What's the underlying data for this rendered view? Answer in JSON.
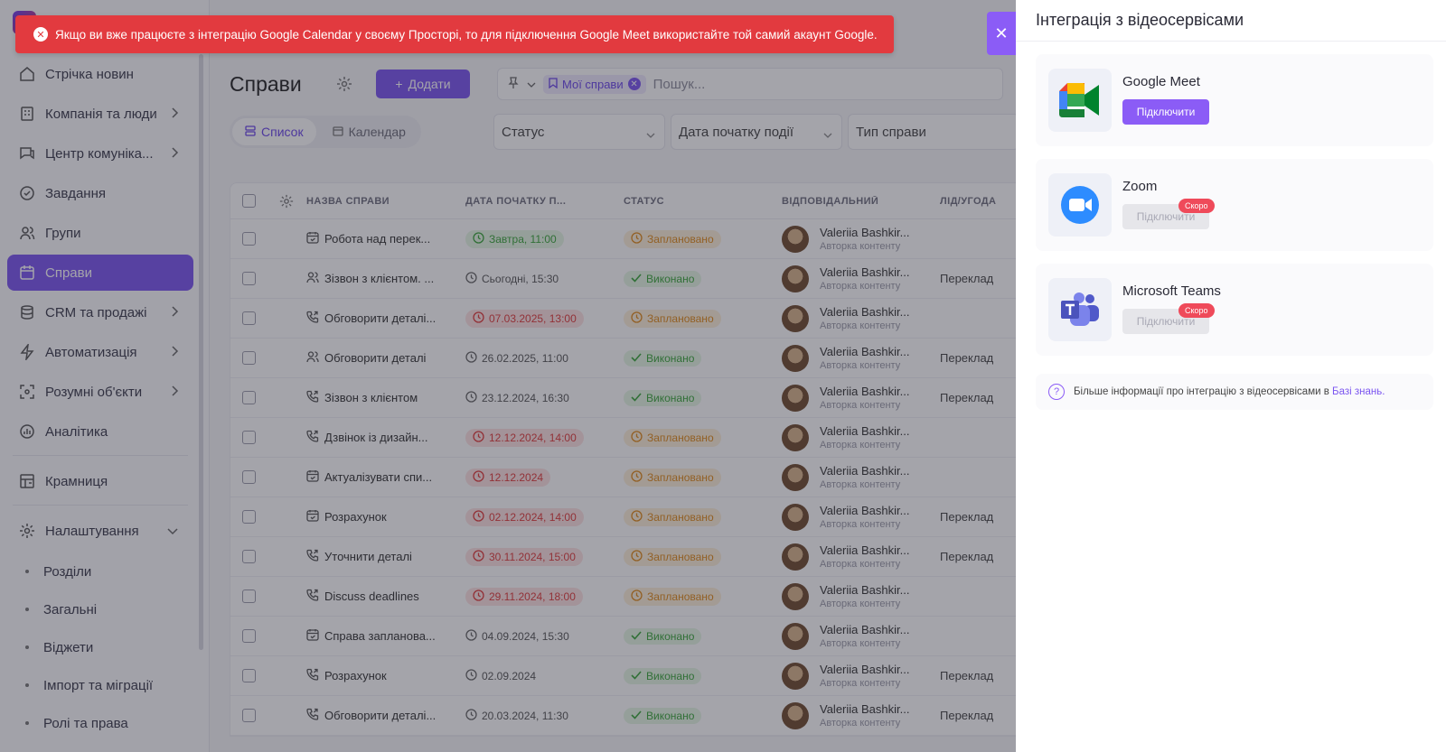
{
  "alert": {
    "text": "Якщо ви вже працюєте з інтеграцію Google Calendar у своєму Просторі, то для підключення Google Meet використайте той самий акаунт Google."
  },
  "sidebar": {
    "items": [
      {
        "label": "Стрічка новин",
        "icon": "newspaper-icon"
      },
      {
        "label": "Компанія та люди",
        "icon": "building-icon",
        "chevron": true
      },
      {
        "label": "Центр комуніка...",
        "icon": "chat-icon",
        "chevron": true
      },
      {
        "label": "Завдання",
        "icon": "check-circle-icon"
      },
      {
        "label": "Групи",
        "icon": "users-icon"
      },
      {
        "label": "Справи",
        "icon": "calendar-icon",
        "active": true
      },
      {
        "label": "CRM та продажі",
        "icon": "database-icon",
        "chevron": true
      },
      {
        "label": "Автоматизація",
        "icon": "bolt-icon",
        "chevron": true
      },
      {
        "label": "Розумні об'єкти",
        "icon": "scan-icon",
        "chevron": true
      },
      {
        "label": "Аналітика",
        "icon": "chart-icon"
      }
    ],
    "store": "Крамниця",
    "settings": "Налаштування",
    "settings_sub": [
      "Розділи",
      "Загальні",
      "Віджети",
      "Імпорт та міграції",
      "Ролі та права"
    ]
  },
  "main": {
    "title": "Справи",
    "add_label": "Додати",
    "filter_chip": "Мої справи",
    "search_placeholder": "Пошук...",
    "view_tabs": [
      "Список",
      "Календар"
    ],
    "filters": [
      "Статус",
      "Дата початку події",
      "Тип справи"
    ],
    "columns": [
      "НАЗВА СПРАВИ",
      "ДАТА ПОЧАТКУ П...",
      "СТАТУС",
      "ВІДПОВІДАЛЬНИЙ",
      "ЛІД/УГОДА"
    ],
    "rows": [
      {
        "name": "Робота над перек...",
        "type": "calendar",
        "date": "Завтра, 11:00",
        "date_style": "green",
        "status": "Заплановано",
        "status_style": "orange",
        "resp": "Valeriia Bashkir...",
        "role": "Авторка контенту",
        "lead": ""
      },
      {
        "name": "Зізвон з клієнтом. ...",
        "type": "users",
        "date": "Сьогодні, 15:30",
        "date_style": "gray",
        "status": "Виконано",
        "status_style": "green",
        "resp": "Valeriia Bashkir...",
        "role": "Авторка контенту",
        "lead": "Переклад"
      },
      {
        "name": "Обговорити деталі...",
        "type": "phone",
        "date": "07.03.2025, 13:00",
        "date_style": "red",
        "status": "Заплановано",
        "status_style": "orange",
        "resp": "Valeriia Bashkir...",
        "role": "Авторка контенту",
        "lead": ""
      },
      {
        "name": "Обговорити деталі",
        "type": "users",
        "date": "26.02.2025, 11:00",
        "date_style": "gray",
        "status": "Виконано",
        "status_style": "green",
        "resp": "Valeriia Bashkir...",
        "role": "Авторка контенту",
        "lead": "Переклад"
      },
      {
        "name": "Зізвон з клієнтом",
        "type": "phone",
        "date": "23.12.2024, 16:30",
        "date_style": "gray",
        "status": "Виконано",
        "status_style": "green",
        "resp": "Valeriia Bashkir...",
        "role": "Авторка контенту",
        "lead": "Переклад"
      },
      {
        "name": "Дзвінок із дизайн...",
        "type": "phone",
        "date": "12.12.2024, 14:00",
        "date_style": "red",
        "status": "Заплановано",
        "status_style": "orange",
        "resp": "Valeriia Bashkir...",
        "role": "Авторка контенту",
        "lead": ""
      },
      {
        "name": "Актуалізувати спи...",
        "type": "calendar",
        "date": "12.12.2024",
        "date_style": "red",
        "status": "Заплановано",
        "status_style": "orange",
        "resp": "Valeriia Bashkir...",
        "role": "Авторка контенту",
        "lead": ""
      },
      {
        "name": "Розрахунок",
        "type": "calendar",
        "date": "02.12.2024, 14:00",
        "date_style": "red",
        "status": "Заплановано",
        "status_style": "orange",
        "resp": "Valeriia Bashkir...",
        "role": "Авторка контенту",
        "lead": "Переклад"
      },
      {
        "name": "Уточнити деталі",
        "type": "phone",
        "date": "30.11.2024, 15:00",
        "date_style": "red",
        "status": "Заплановано",
        "status_style": "orange",
        "resp": "Valeriia Bashkir...",
        "role": "Авторка контенту",
        "lead": "Переклад"
      },
      {
        "name": "Discuss deadlines",
        "type": "phone",
        "date": "29.11.2024, 18:00",
        "date_style": "red",
        "status": "Заплановано",
        "status_style": "orange",
        "resp": "Valeriia Bashkir...",
        "role": "Авторка контенту",
        "lead": ""
      },
      {
        "name": "Справа запланова...",
        "type": "calendar",
        "date": "04.09.2024, 15:30",
        "date_style": "gray",
        "status": "Виконано",
        "status_style": "green",
        "resp": "Valeriia Bashkir...",
        "role": "Авторка контенту",
        "lead": ""
      },
      {
        "name": "Розрахунок",
        "type": "phone",
        "date": "02.09.2024",
        "date_style": "gray",
        "status": "Виконано",
        "status_style": "green",
        "resp": "Valeriia Bashkir...",
        "role": "Авторка контенту",
        "lead": "Переклад"
      },
      {
        "name": "Обговорити деталі...",
        "type": "phone",
        "date": "20.03.2024, 11:30",
        "date_style": "gray",
        "status": "Виконано",
        "status_style": "green",
        "resp": "Valeriia Bashkir...",
        "role": "Авторка контенту",
        "lead": "Переклад"
      }
    ]
  },
  "drawer": {
    "title": "Інтеграція з відеосервісами",
    "close_icon": "close-icon",
    "services": [
      {
        "name": "Google Meet",
        "button": "Підключити",
        "enabled": true,
        "badge": ""
      },
      {
        "name": "Zoom",
        "button": "Підключити",
        "enabled": false,
        "badge": "Скоро"
      },
      {
        "name": "Microsoft Teams",
        "button": "Підключити",
        "enabled": false,
        "badge": "Скоро"
      }
    ],
    "info_text": "Більше інформації про інтеграцію з відеосервісами в",
    "info_link": "Базі знань."
  },
  "colors": {
    "accent": "#7b55f0",
    "alert_red": "#e23a3f",
    "badge_red": "#ef4a5a"
  }
}
